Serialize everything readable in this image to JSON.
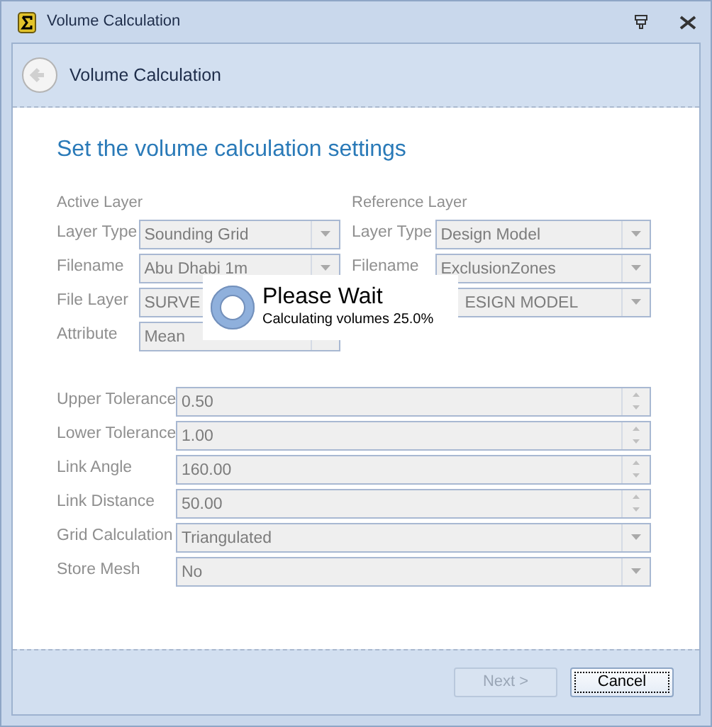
{
  "window": {
    "title": "Volume Calculation"
  },
  "header": {
    "title": "Volume Calculation"
  },
  "heading": "Set the volume calculation settings",
  "active_layer": {
    "title": "Active Layer",
    "fields": [
      {
        "label": "Layer Type",
        "value": "Sounding Grid",
        "kind": "combo",
        "disabled": true
      },
      {
        "label": "Filename",
        "value": "Abu Dhabi 1m",
        "kind": "combo",
        "disabled": true
      },
      {
        "label": "File Layer",
        "value": "SURVE",
        "kind": "combo",
        "disabled": true
      },
      {
        "label": "Attribute",
        "value": "Mean",
        "kind": "combo",
        "disabled": true
      }
    ]
  },
  "reference_layer": {
    "title": "Reference Layer",
    "fields": [
      {
        "label": "Layer Type",
        "value": "Design Model",
        "kind": "combo",
        "disabled": true
      },
      {
        "label": "Filename",
        "value": "ExclusionZones",
        "kind": "combo",
        "disabled": true
      },
      {
        "value": "ESIGN MODEL",
        "kind": "combo",
        "disabled": true
      }
    ]
  },
  "settings": [
    {
      "label": "Upper Tolerance",
      "value": "0.50",
      "kind": "spin",
      "disabled": true
    },
    {
      "label": "Lower Tolerance",
      "value": "1.00",
      "kind": "spin",
      "disabled": true
    },
    {
      "label": "Link Angle",
      "value": "160.00",
      "kind": "spin",
      "disabled": true
    },
    {
      "label": "Link Distance",
      "value": "50.00",
      "kind": "spin",
      "disabled": true
    },
    {
      "label": "Grid Calculation",
      "value": "Triangulated",
      "kind": "combo",
      "disabled": true
    },
    {
      "label": "Store Mesh",
      "value": "No",
      "kind": "combo",
      "disabled": true
    }
  ],
  "wait_popup": {
    "title": "Please Wait",
    "message": "Calculating volumes 25.0%"
  },
  "buttons": [
    {
      "label": "Next >",
      "disabled": true,
      "focused": false
    },
    {
      "label": "Cancel",
      "disabled": false,
      "focused": true
    }
  ]
}
